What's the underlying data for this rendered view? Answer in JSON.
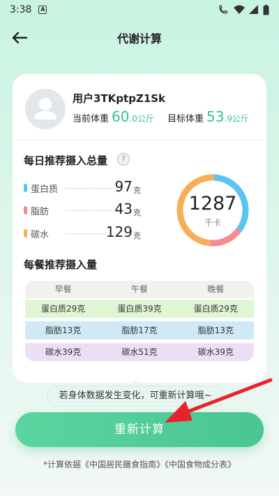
{
  "status_bar": {
    "time": "3:38",
    "left_icon": "A"
  },
  "header": {
    "title": "代谢计算"
  },
  "user": {
    "name": "用户3TKptpZ1Sk",
    "current_weight_label": "当前体重",
    "current_weight_int": "60",
    "current_weight_dec": ".0",
    "current_weight_unit": "公斤",
    "target_weight_label": "目标体重",
    "target_weight_int": "53",
    "target_weight_dec": ".9",
    "target_weight_unit": "公斤"
  },
  "daily": {
    "title": "每日推荐摄入总量",
    "help": "?",
    "macros": [
      {
        "label": "蛋白质",
        "value": "97",
        "unit": "克",
        "color": "#59c6f2"
      },
      {
        "label": "脂肪",
        "value": "43",
        "unit": "克",
        "color": "#f58c92"
      },
      {
        "label": "碳水",
        "value": "129",
        "unit": "克",
        "color": "#f8ad57"
      }
    ],
    "total": "1287",
    "total_unit": "千卡"
  },
  "meals": {
    "title": "每餐推荐摄入量",
    "columns": [
      "早餐",
      "午餐",
      "晚餐"
    ],
    "rows": [
      {
        "cells": [
          "蛋白质29克",
          "蛋白质39克",
          "蛋白质29克"
        ],
        "color": "#dff5d4"
      },
      {
        "cells": [
          "脂肪13克",
          "脂肪17克",
          "脂肪13克"
        ],
        "color": "#cfeaf6"
      },
      {
        "cells": [
          "碳水39克",
          "碳水51克",
          "碳水39克"
        ],
        "color": "#ebdff6"
      }
    ]
  },
  "tip": "若身体数据发生变化，可重新计算哦~",
  "recalc_button": "重新计算",
  "footnote": "*计算依据《中国居民膳食指南》《中国食物成分表》",
  "colors": {
    "accent": "#49c693",
    "arrow": "#e8232a"
  }
}
